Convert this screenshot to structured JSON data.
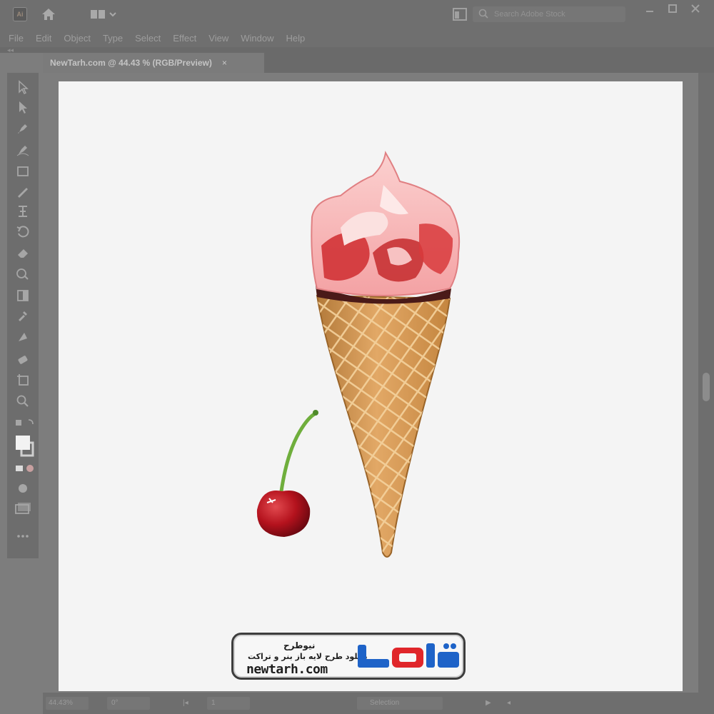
{
  "app": {
    "logo_text": "Ai",
    "search_placeholder": "Search Adobe Stock"
  },
  "menu": [
    "File",
    "Edit",
    "Object",
    "Type",
    "Select",
    "Effect",
    "View",
    "Window",
    "Help"
  ],
  "tab": {
    "title": "NewTarh.com @ 44.43 % (RGB/Preview)",
    "close": "×"
  },
  "status": {
    "zoom": "44.43%",
    "rotation": "0°",
    "artboard": "1",
    "mode": "Selection"
  },
  "watermark": {
    "site_name": "نیوطرح",
    "tagline": "دانلود طرح لایه باز بنر و تراکت",
    "url": "newtarh.com",
    "logo_text": "نیوطرح"
  },
  "colors": {
    "ui_bg": "#7d7d7d",
    "artboard": "#f4f4f4",
    "brand_blue": "#1e63c8",
    "brand_red": "#e0262a"
  }
}
